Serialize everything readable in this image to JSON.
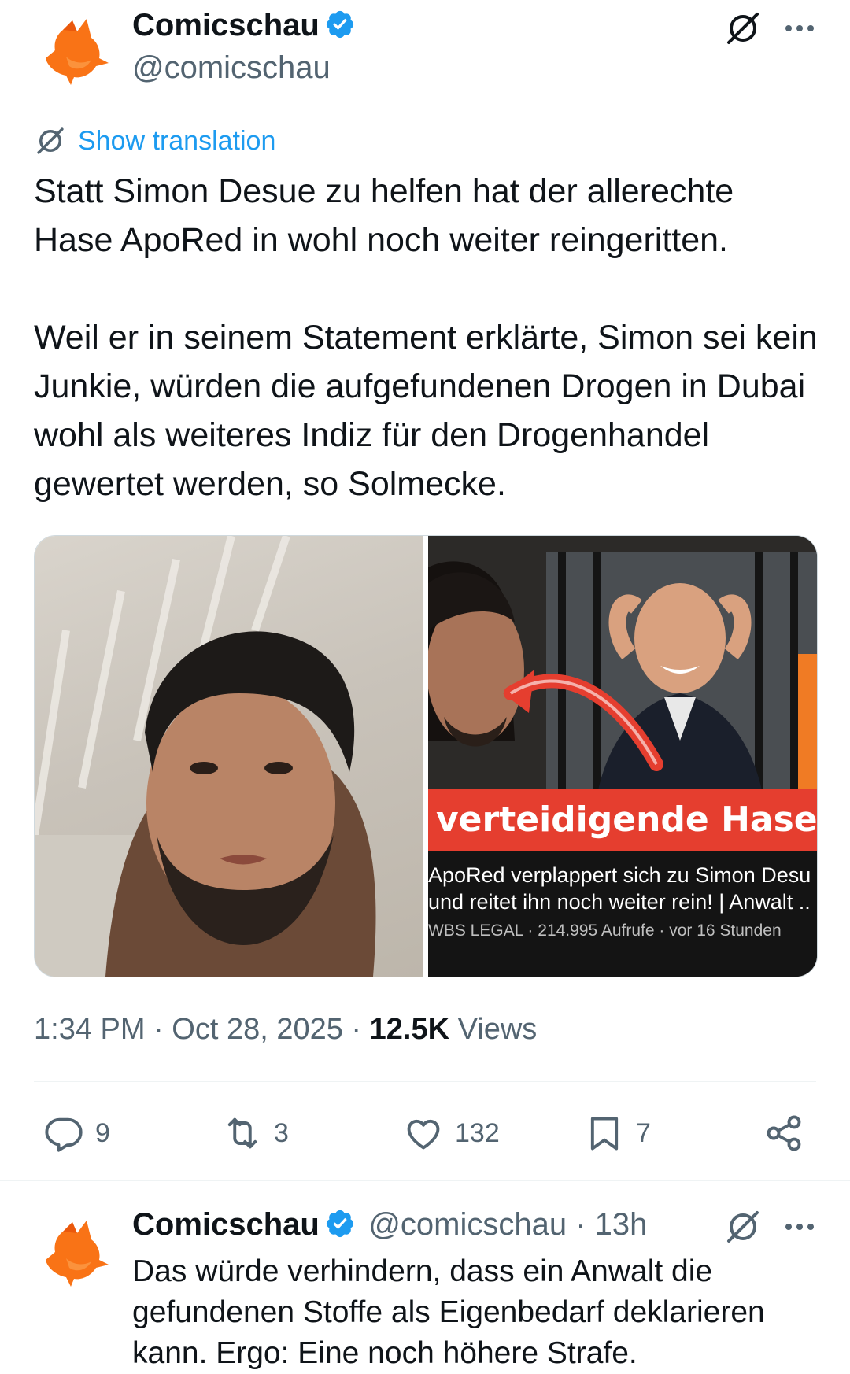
{
  "tweet": {
    "author_name": "Comicschau",
    "author_handle": "@comicschau",
    "translation_link": "Show translation",
    "text": "Statt Simon Desue zu helfen hat der allerechte Hase ApoRed in wohl noch weiter reingeritten.\n\nWeil er in seinem Statement erklärte, Simon sei kein Junkie, würden die aufgefundenen Drogen in Dubai wohl als weiteres Indiz für den Drogenhandel gewertet werden, so Solmecke.",
    "media_right": {
      "banner": "verteidigende Hase",
      "video_title_line1": "ApoRed verplappert sich zu Simon Desu",
      "video_title_line2": "und reitet ihn noch weiter rein! | Anwalt ..",
      "video_meta": "WBS LEGAL · 214.995 Aufrufe · vor 16 Stunden"
    },
    "time": "1:34 PM · Oct 28, 2025 · ",
    "views_count": "12.5K",
    "views_label": " Views",
    "actions": {
      "replies": "9",
      "reposts": "3",
      "likes": "132",
      "bookmarks": "7"
    }
  },
  "reply": {
    "author_name": "Comicschau",
    "author_handle": "@comicschau · 13h",
    "text": "Das würde verhindern, dass ein Anwalt die\ngefundenen Stoffe als Eigenbedarf deklarieren\nkann. Ergo: Eine noch höhere Strafe."
  },
  "colors": {
    "accent_blue": "#1d9bf0",
    "secondary_text": "#536471",
    "avatar_orange": "#f97316",
    "banner_red": "#e53e2f"
  },
  "icons": [
    "fox-avatar-icon",
    "verified-badge-icon",
    "grok-icon",
    "more-icon",
    "reply-icon",
    "repost-icon",
    "like-icon",
    "bookmark-icon",
    "share-icon"
  ]
}
